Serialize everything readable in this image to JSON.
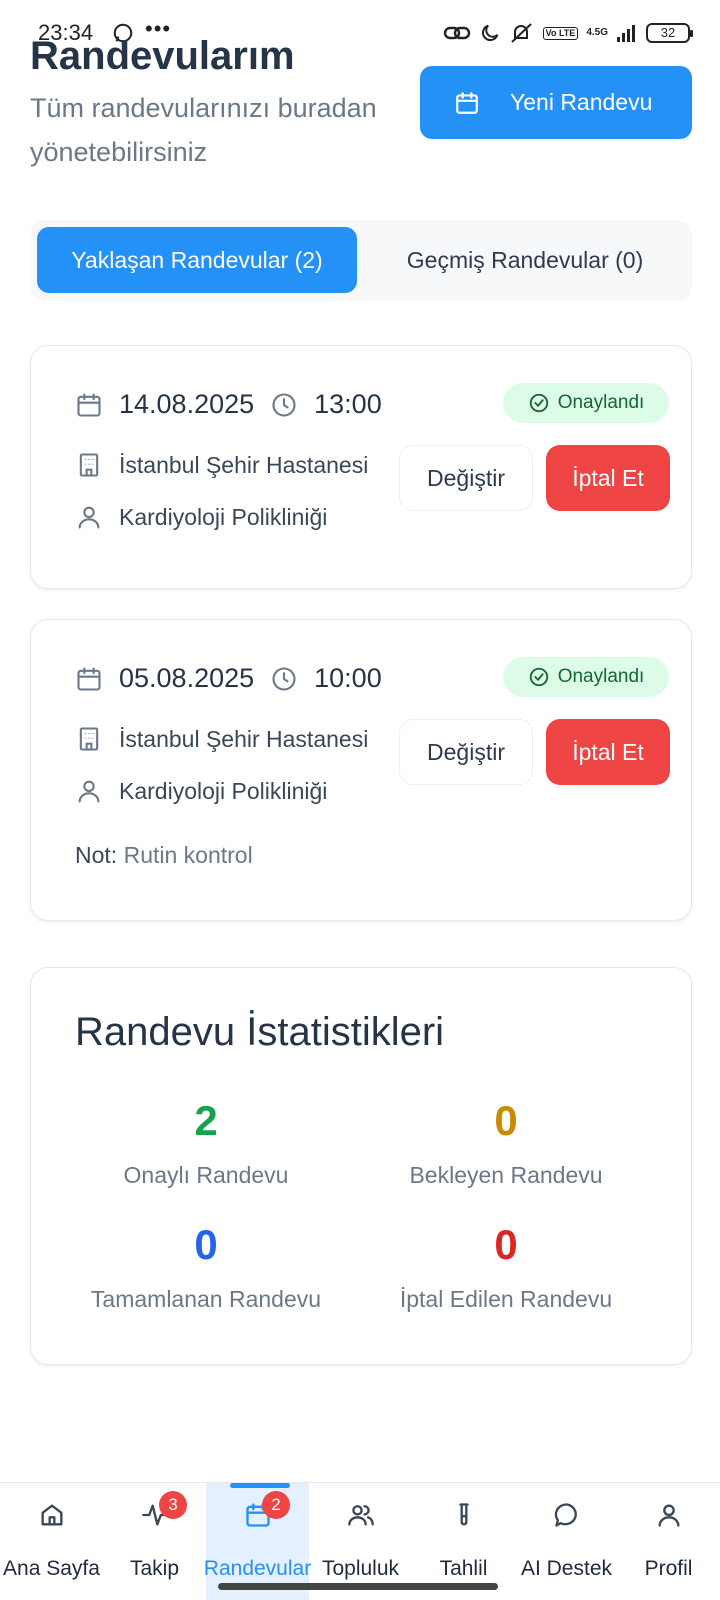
{
  "status_bar": {
    "time": "23:34",
    "dots": "•••",
    "network": "4.5G",
    "lte": "Vo LTE",
    "battery": "32"
  },
  "header": {
    "title": "Randevularım",
    "subtitle": "Tüm randevularınızı buradan yönetebilirsiniz",
    "new_button_label": "Yeni Randevu"
  },
  "tabs": [
    {
      "label": "Yaklaşan Randevular (2)",
      "active": true
    },
    {
      "label": "Geçmiş Randevular (0)",
      "active": false
    }
  ],
  "appointments": [
    {
      "date": "14.08.2025",
      "time": "13:00",
      "status": "Onaylandı",
      "hospital": "İstanbul Şehir Hastanesi",
      "department": "Kardiyoloji Polikliniği",
      "change_label": "Değiştir",
      "cancel_label": "İptal Et"
    },
    {
      "date": "05.08.2025",
      "time": "10:00",
      "status": "Onaylandı",
      "hospital": "İstanbul Şehir Hastanesi",
      "department": "Kardiyoloji Polikliniği",
      "note_label": "Not:",
      "note": "Rutin kontrol",
      "change_label": "Değiştir",
      "cancel_label": "İptal Et"
    }
  ],
  "stats": {
    "title": "Randevu İstatistikleri",
    "items": [
      {
        "value": "2",
        "label": "Onaylı Randevu",
        "color": "#16a34a"
      },
      {
        "value": "0",
        "label": "Bekleyen Randevu",
        "color": "#ca8a04"
      },
      {
        "value": "0",
        "label": "Tamamlanan Randevu",
        "color": "#2563eb"
      },
      {
        "value": "0",
        "label": "İptal Edilen Randevu",
        "color": "#dc2626"
      }
    ]
  },
  "bottom_nav": [
    {
      "label": "Ana Sayfa",
      "icon": "home-icon"
    },
    {
      "label": "Takip",
      "icon": "activity-icon",
      "badge": "3"
    },
    {
      "label": "Randevular",
      "icon": "calendar-icon",
      "badge": "2",
      "active": true
    },
    {
      "label": "Topluluk",
      "icon": "users-icon"
    },
    {
      "label": "Tahlil",
      "icon": "test-tube-icon"
    },
    {
      "label": "AI Destek",
      "icon": "chat-icon"
    },
    {
      "label": "Profil",
      "icon": "user-icon"
    }
  ],
  "colors": {
    "primary": "#2491f7",
    "danger": "#ef4444",
    "success_bg": "#dcfce7",
    "success_text": "#166534"
  }
}
